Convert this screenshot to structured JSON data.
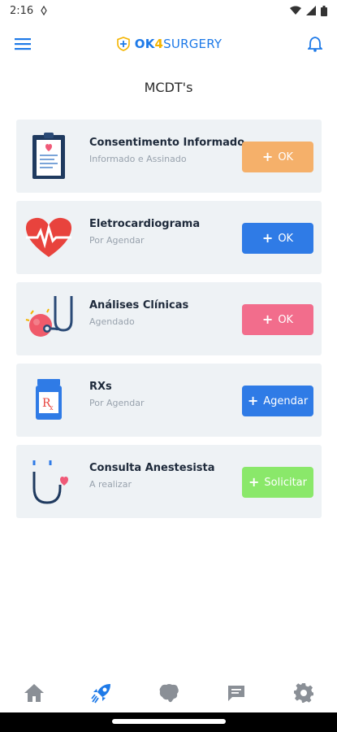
{
  "status_bar": {
    "time": "2:16"
  },
  "header": {
    "logo_ok": "OK",
    "logo_four": "4",
    "logo_surgery": "SURGERY"
  },
  "page": {
    "title": "MCDT's"
  },
  "cards": [
    {
      "title": "Consentimento Informado",
      "subtitle": "Informado e Assinado",
      "button": "OK",
      "button_color": "#f5b06a",
      "icon": "clipboard-icon"
    },
    {
      "title": "Eletrocardiograma",
      "subtitle": "Por Agendar",
      "button": "OK",
      "button_color": "#2f7be6",
      "icon": "heart-ecg-icon"
    },
    {
      "title": "Análises Clínicas",
      "subtitle": "Agendado",
      "button": "OK",
      "button_color": "#f26d8c",
      "icon": "stethoscope-icon"
    },
    {
      "title": "RXs",
      "subtitle": "Por Agendar",
      "button": "Agendar",
      "button_color": "#2f7be6",
      "icon": "rx-bottle-icon"
    },
    {
      "title": "Consulta Anestesista",
      "subtitle": "A realizar",
      "button": "Solicitar",
      "button_color": "#8ae86a",
      "icon": "stethoscope-heart-icon"
    }
  ],
  "bottom_nav": [
    {
      "name": "home",
      "icon": "home-icon"
    },
    {
      "name": "rocket",
      "icon": "rocket-icon",
      "active": true
    },
    {
      "name": "map",
      "icon": "map-icon"
    },
    {
      "name": "chat",
      "icon": "chat-icon"
    },
    {
      "name": "settings",
      "icon": "gear-icon"
    }
  ],
  "colors": {
    "accent": "#1e7ae8",
    "card_bg": "#eef2f5",
    "nav_inactive": "#8a8f96"
  }
}
